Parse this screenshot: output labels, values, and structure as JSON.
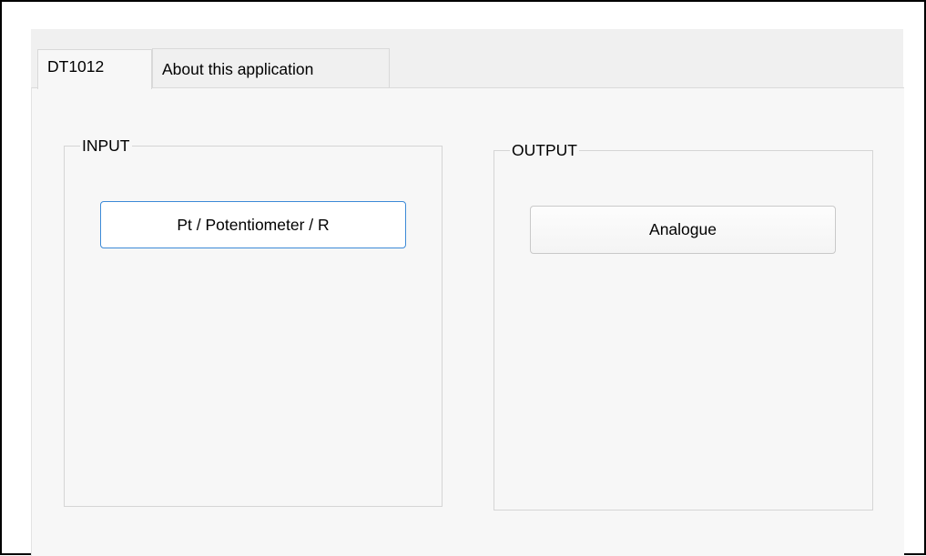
{
  "tabs": [
    {
      "label": "DT1012",
      "active": true
    },
    {
      "label": "About this application",
      "active": false
    }
  ],
  "input_group": {
    "title": "INPUT",
    "button_label": "Pt / Potentiometer / R"
  },
  "output_group": {
    "title": "OUTPUT",
    "button_label": "Analogue"
  },
  "colors": {
    "focus_border": "#3c8ad7",
    "panel_background": "#f7f7f7",
    "tab_strip_background": "#f0f0f0",
    "outer_frame": "#000000"
  }
}
